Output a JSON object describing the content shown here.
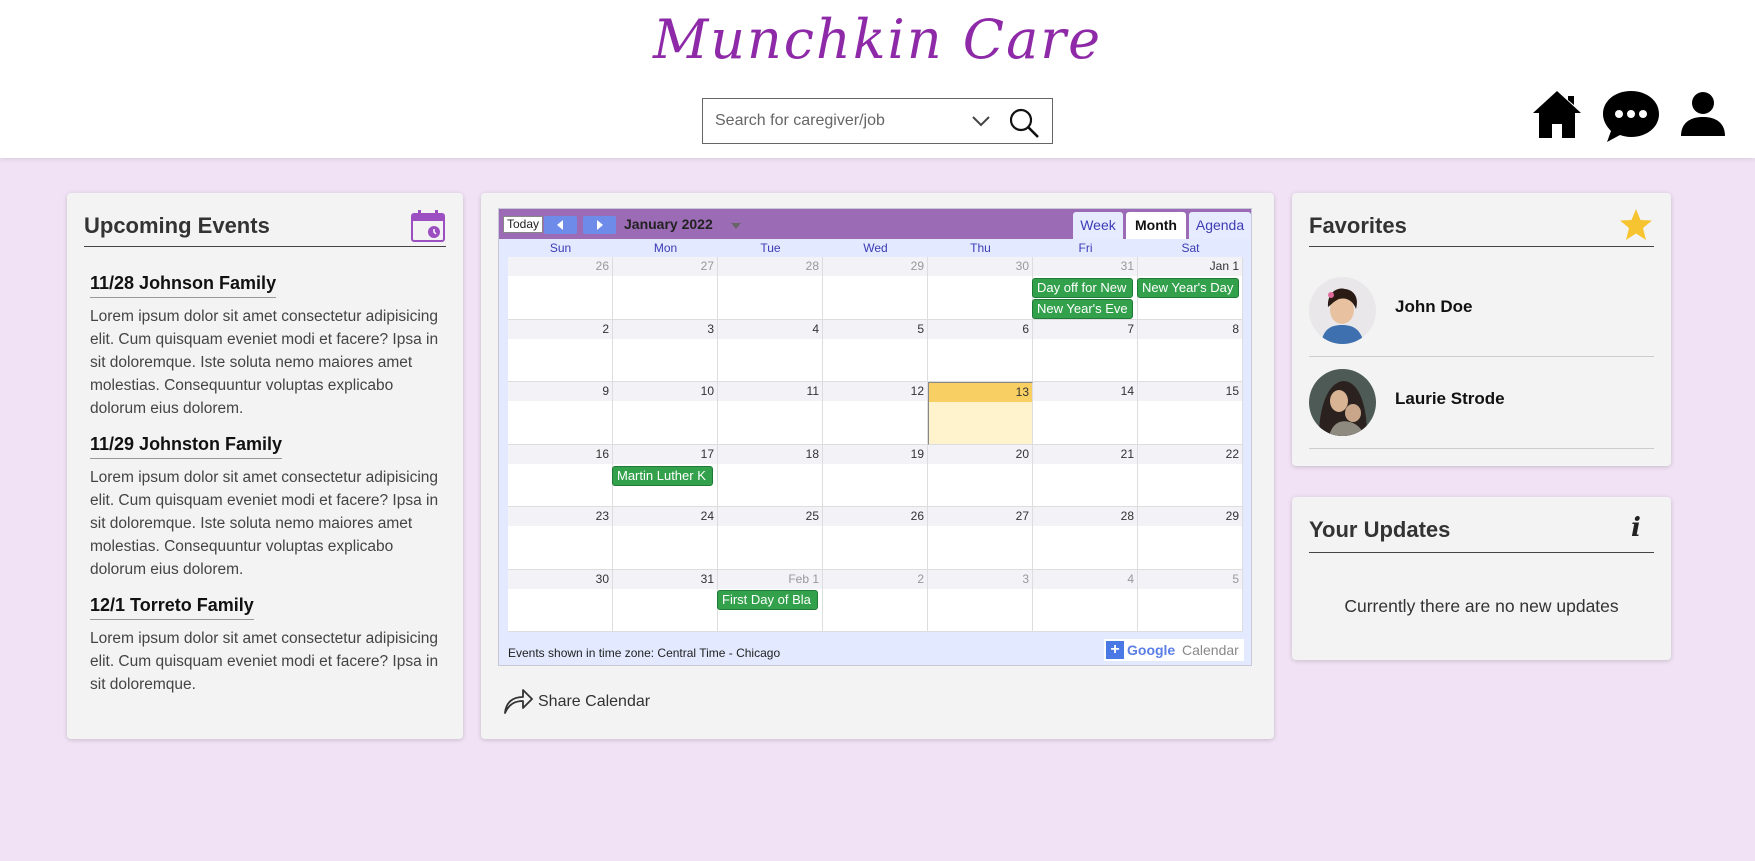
{
  "header": {
    "brand": "Munchkin Care",
    "search": {
      "placeholder": "Search for caregiver/job"
    }
  },
  "upcoming": {
    "title": "Upcoming Events",
    "events": [
      {
        "title": "11/28 Johnson Family",
        "text": "Lorem ipsum dolor sit amet consectetur adipisicing elit. Cum quisquam eveniet modi et facere? Ipsa in sit doloremque. Iste soluta nemo maiores amet molestias. Consequuntur voluptas explicabo dolorum eius dolorem."
      },
      {
        "title": "11/29 Johnston Family",
        "text": "Lorem ipsum dolor sit amet consectetur adipisicing elit. Cum quisquam eveniet modi et facere? Ipsa in sit doloremque. Iste soluta nemo maiores amet molestias. Consequuntur voluptas explicabo dolorum eius dolorem."
      },
      {
        "title": "12/1 Torreto Family",
        "text": "Lorem ipsum dolor sit amet consectetur adipisicing elit. Cum quisquam eveniet modi et facere? Ipsa in sit doloremque."
      }
    ]
  },
  "calendar": {
    "today_label": "Today",
    "month_label": "January 2022",
    "tabs": [
      "Week",
      "Month",
      "Agenda"
    ],
    "active_tab": "Month",
    "weekdays": [
      "Sun",
      "Mon",
      "Tue",
      "Wed",
      "Thu",
      "Fri",
      "Sat"
    ],
    "weeks": [
      [
        "26",
        "27",
        "28",
        "29",
        "30",
        "31",
        "Jan 1"
      ],
      [
        "2",
        "3",
        "4",
        "5",
        "6",
        "7",
        "8"
      ],
      [
        "9",
        "10",
        "11",
        "12",
        "13",
        "14",
        "15"
      ],
      [
        "16",
        "17",
        "18",
        "19",
        "20",
        "21",
        "22"
      ],
      [
        "23",
        "24",
        "25",
        "26",
        "27",
        "28",
        "29"
      ],
      [
        "30",
        "31",
        "Feb 1",
        "2",
        "3",
        "4",
        "5"
      ]
    ],
    "today_date": "13",
    "events": {
      "day_off": "Day off for New",
      "new_years_eve": "New Year's Eve",
      "new_years_day": "New Year's Day",
      "mlk": "Martin Luther K",
      "black_history": "First Day of Bla"
    },
    "timezone_note": "Events shown in time zone: Central Time - Chicago",
    "google_plus": "+",
    "google_word": "Google",
    "calendar_word": "Calendar",
    "share_label": "Share Calendar"
  },
  "favorites": {
    "title": "Favorites",
    "people": [
      {
        "name": "John Doe"
      },
      {
        "name": "Laurie Strode"
      }
    ]
  },
  "updates": {
    "title": "Your Updates",
    "info_glyph": "i",
    "message": "Currently there are no new updates"
  },
  "colors": {
    "brand": "#8e2aa8",
    "page_bg": "#f1e3f5",
    "calendar_bar": "#9c6bb5",
    "event_green": "#33a04c",
    "today_highlight": "#f8cf62",
    "star": "#f6c430"
  },
  "icons": [
    "chevron-down-icon",
    "search-icon",
    "home-icon",
    "chat-icon",
    "user-icon",
    "calendar-icon",
    "star-icon",
    "info-icon",
    "share-icon"
  ]
}
